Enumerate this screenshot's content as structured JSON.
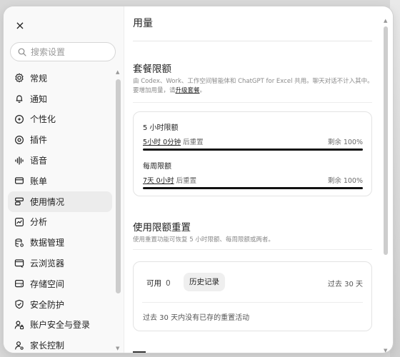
{
  "window": {
    "close_label": "×"
  },
  "sidebar": {
    "search": {
      "placeholder": "搜索设置",
      "value": ""
    },
    "items": [
      {
        "label": "常规",
        "icon": "gear-icon"
      },
      {
        "label": "通知",
        "icon": "bell-icon"
      },
      {
        "label": "个性化",
        "icon": "sparkle-icon"
      },
      {
        "label": "插件",
        "icon": "plugin-icon"
      },
      {
        "label": "语音",
        "icon": "waveform-icon"
      },
      {
        "label": "账单",
        "icon": "card-icon"
      },
      {
        "label": "使用情况",
        "icon": "usage-icon",
        "active": true
      },
      {
        "label": "分析",
        "icon": "chart-icon"
      },
      {
        "label": "数据管理",
        "icon": "database-icon"
      },
      {
        "label": "云浏览器",
        "icon": "cloud-browser-icon"
      },
      {
        "label": "存储空间",
        "icon": "storage-icon"
      },
      {
        "label": "安全防护",
        "icon": "shield-icon"
      },
      {
        "label": "账户安全与登录",
        "icon": "account-security-icon"
      },
      {
        "label": "家长控制",
        "icon": "parent-control-icon"
      }
    ]
  },
  "main": {
    "title": "用量",
    "plan_limits": {
      "heading": "套餐限额",
      "desc_before_link": "由 Codex、Work、工作空间智能体和 ChatGPT for Excel 共用。聊天对话不计入其中。要增加用量，请",
      "link": "升级套餐",
      "desc_after_link": "。",
      "limits": [
        {
          "name": "5 小时限额",
          "reset_time": "5小时 0分钟",
          "reset_suffix": " 后重置",
          "remaining": "剩余 100%",
          "remaining_fraction": 1.0
        },
        {
          "name": "每周限额",
          "reset_time": "7天 0小时",
          "reset_suffix": " 后重置",
          "remaining": "剩余 100%",
          "remaining_fraction": 1.0
        }
      ]
    },
    "usage_reset": {
      "heading": "使用限额重置",
      "desc": "使用重置功能可恢复 5 小时限额、每周限额或两者。",
      "available_label": "可用",
      "available_count": "0",
      "history_button": "历史记录",
      "period": "过去 30 天",
      "empty_text": "过去 30 天内没有已存的重置活动"
    }
  },
  "colors": {
    "accent": "#111111",
    "active_item_bg": "#ececec",
    "muted_text": "#8a8a8a"
  }
}
